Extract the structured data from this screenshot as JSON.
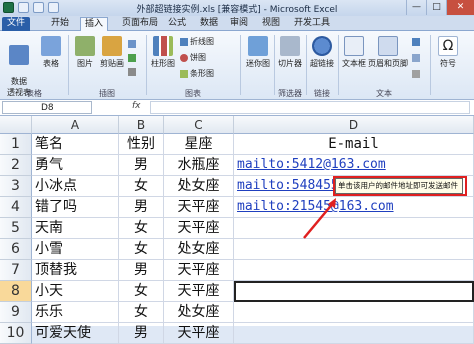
{
  "window": {
    "title": "外部超链接实例.xls [兼容模式] - Microsoft Excel",
    "controls": [
      "—",
      "□",
      "✕"
    ]
  },
  "tabs": [
    "文件",
    "开始",
    "插入",
    "页面布局",
    "公式",
    "数据",
    "审阅",
    "视图",
    "开发工具"
  ],
  "active_tab": "插入",
  "ribbon": {
    "pivot_table": "数据\n透视表",
    "table": "表格",
    "picture": "图片",
    "clipart": "剪贴画",
    "column_chart": "柱形图",
    "line_chart": "折线图",
    "pie_chart": "饼图",
    "bar_chart": "条形图",
    "sparkline": "迷你图",
    "slicer": "切片器",
    "hyperlink": "超链接",
    "textbox": "文本框",
    "header_footer": "页眉和页脚",
    "symbol": "符号",
    "groups": {
      "tables": "表格",
      "illustrations": "插图",
      "charts": "图表",
      "filter": "筛选器",
      "links": "链接",
      "text": "文本"
    }
  },
  "formula_bar": {
    "name_box": "D8",
    "fx": "fx",
    "value": ""
  },
  "columns": [
    "A",
    "B",
    "C",
    "D"
  ],
  "rows": [
    {
      "n": "1",
      "a": "笔名",
      "b": "性别",
      "c": "星座",
      "d": "E-mail"
    },
    {
      "n": "2",
      "a": "勇气",
      "b": "男",
      "c": "水瓶座",
      "d": "mailto:5412@163.com"
    },
    {
      "n": "3",
      "a": "小冰点",
      "b": "女",
      "c": "处女座",
      "d": "mailto:548455"
    },
    {
      "n": "4",
      "a": "错了吗",
      "b": "男",
      "c": "天平座",
      "d": "mailto:21545@163.com"
    },
    {
      "n": "5",
      "a": "天南",
      "b": "女",
      "c": "天平座",
      "d": ""
    },
    {
      "n": "6",
      "a": "小雪",
      "b": "女",
      "c": "处女座",
      "d": ""
    },
    {
      "n": "7",
      "a": "顶替我",
      "b": "男",
      "c": "天平座",
      "d": ""
    },
    {
      "n": "8",
      "a": "小天",
      "b": "女",
      "c": "天平座",
      "d": ""
    },
    {
      "n": "9",
      "a": "乐乐",
      "b": "女",
      "c": "处女座",
      "d": ""
    },
    {
      "n": "10",
      "a": "可爱天使",
      "b": "男",
      "c": "天平座",
      "d": ""
    }
  ],
  "tooltip": "单击该用户的邮件地址即可发送邮件",
  "colors": {
    "link": "#1f3fbf",
    "highlight": "#e02020",
    "file_tab": "#2a5ea8"
  }
}
